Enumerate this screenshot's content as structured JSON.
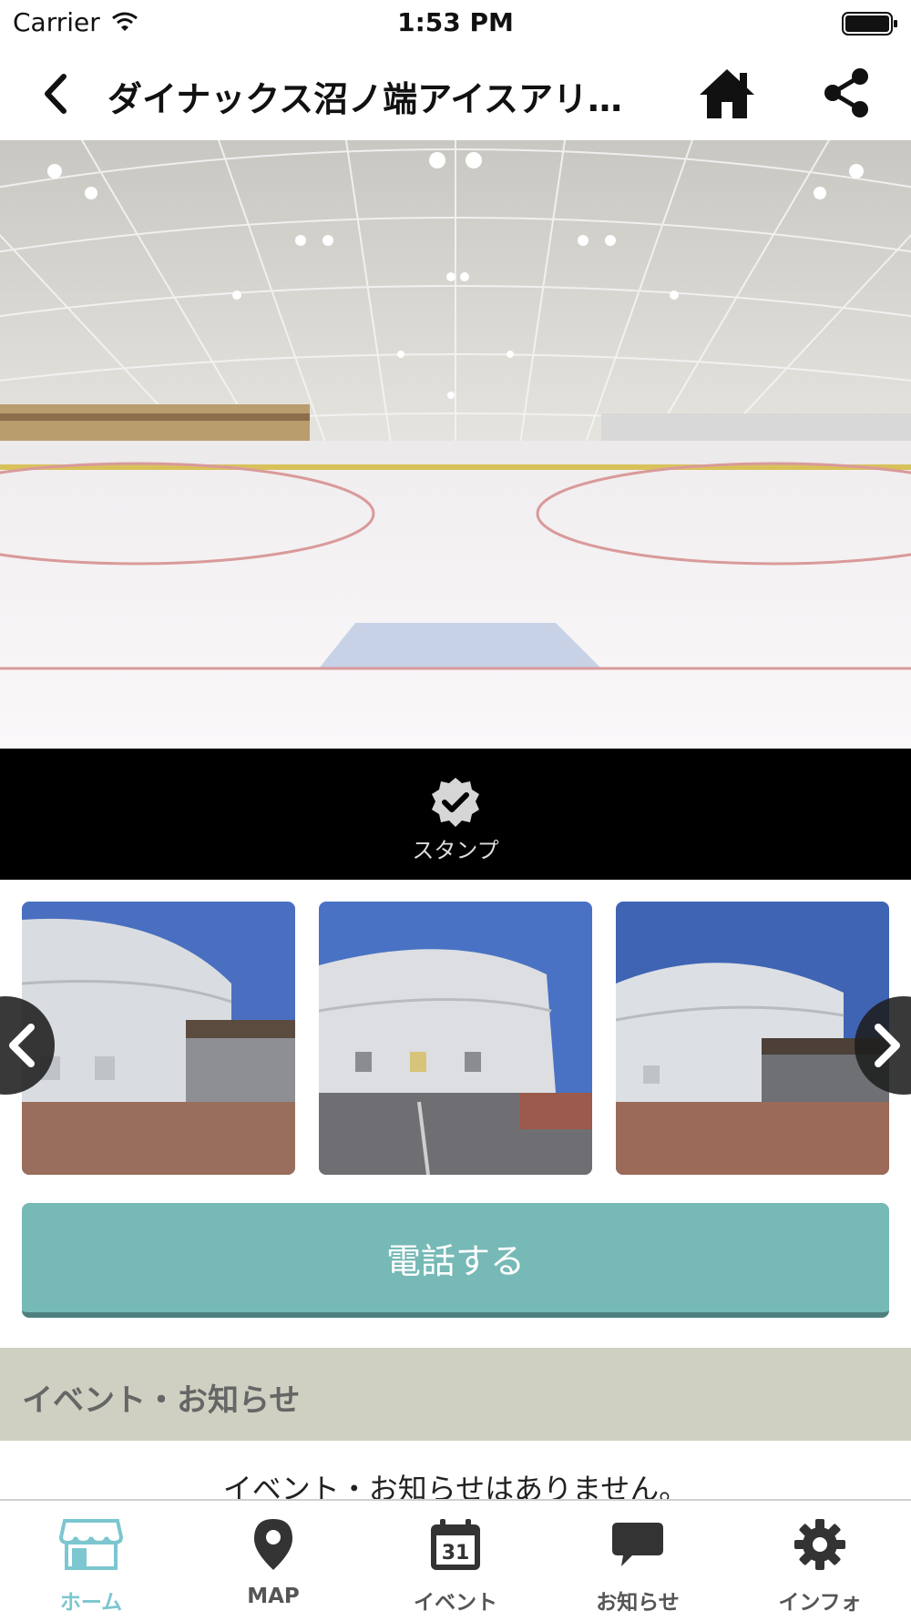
{
  "status_bar": {
    "carrier": "Carrier",
    "time": "1:53 PM"
  },
  "nav": {
    "title": "ダイナックス沼ノ端アイスアリ…"
  },
  "stamp": {
    "label": "スタンプ"
  },
  "call_button": {
    "label": "電話する"
  },
  "section": {
    "title": "イベント・お知らせ",
    "empty_message": "イベント・お知らせはありません。"
  },
  "tabs": [
    {
      "label": "ホーム",
      "icon": "shop-icon",
      "active": true
    },
    {
      "label": "MAP",
      "icon": "map-pin-icon",
      "active": false
    },
    {
      "label": "イベント",
      "icon": "calendar-icon",
      "calendar_day": "31",
      "active": false
    },
    {
      "label": "お知らせ",
      "icon": "chat-bubble-icon",
      "active": false
    },
    {
      "label": "インフォ",
      "icon": "gear-icon",
      "active": false
    }
  ],
  "colors": {
    "accent": "#7cc6cf",
    "call_button": "#76b9b6",
    "section_header": "#cfd0c1"
  }
}
